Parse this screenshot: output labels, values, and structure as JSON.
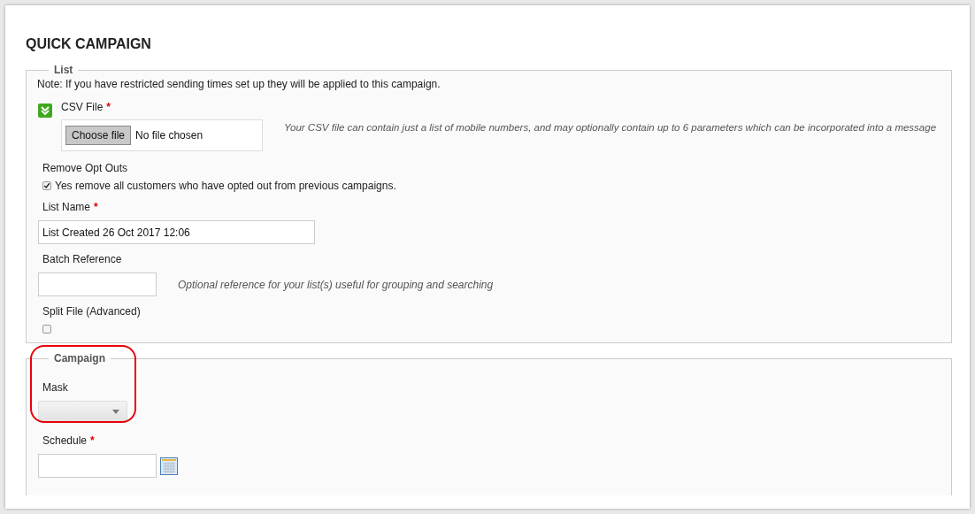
{
  "title": "QUICK CAMPAIGN",
  "list_section": {
    "legend": "List",
    "note": "Note: If you have restricted sending times set up they will be applied to this campaign.",
    "csv_file": {
      "label": "CSV File",
      "required": "*",
      "button": "Choose file",
      "status": "No file chosen",
      "help": "Your CSV file can contain just a list of mobile numbers, and may optionally contain up to 6 parameters which can be incorporated into a message"
    },
    "remove_opt_outs": {
      "label": "Remove Opt Outs",
      "checkbox_label": "Yes remove all customers who have opted out from previous campaigns.",
      "checked": true
    },
    "list_name": {
      "label": "List Name",
      "required": "*",
      "value": "List Created 26 Oct 2017 12:06"
    },
    "batch_reference": {
      "label": "Batch Reference",
      "help": "Optional reference for your list(s) useful for grouping and searching"
    },
    "split_file": {
      "label": "Split File (Advanced)",
      "checked": false
    }
  },
  "campaign_section": {
    "legend": "Campaign",
    "mask": {
      "label": "Mask",
      "highlighted": true
    },
    "schedule": {
      "label": "Schedule",
      "required": "*"
    }
  }
}
